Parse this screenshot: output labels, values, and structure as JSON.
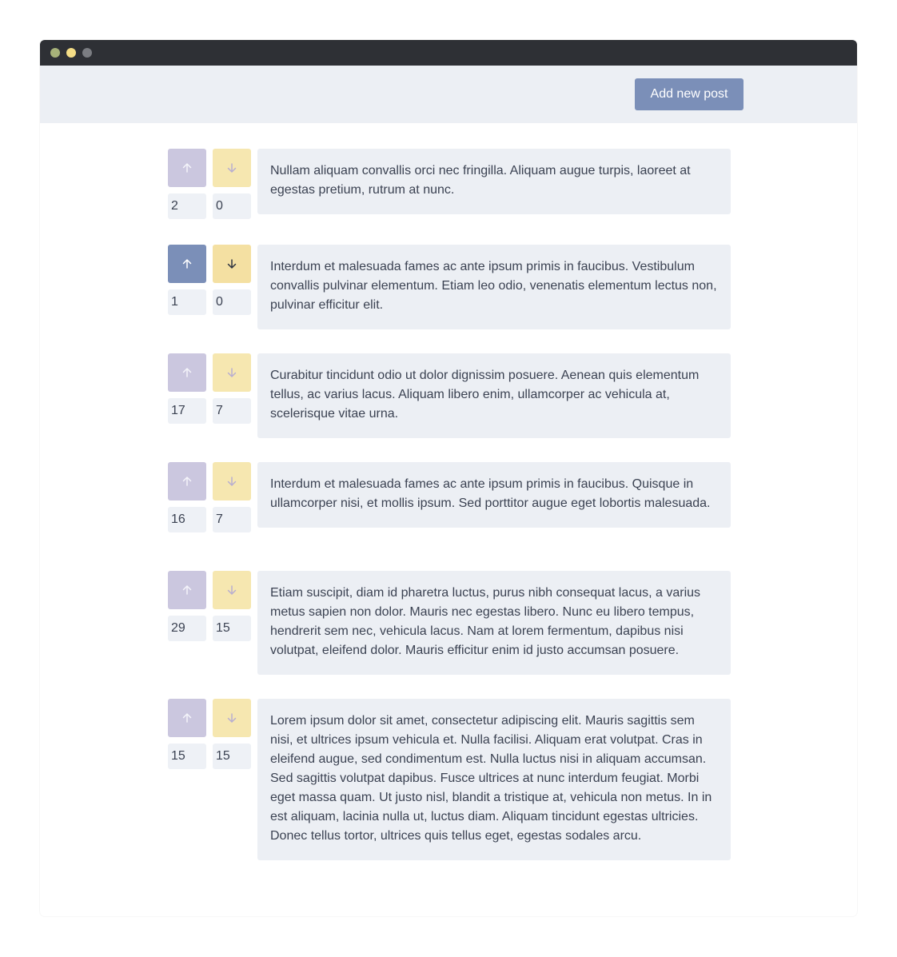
{
  "header": {
    "add_button_label": "Add new post"
  },
  "colors": {
    "titlebar": "#2e3035",
    "header_bg": "#eceff4",
    "accent": "#7b8fb8",
    "upvote_inactive": "#cbc7df",
    "downvote_inactive": "#f6e7b0"
  },
  "posts": [
    {
      "upvotes": "2",
      "downvotes": "0",
      "text": "Nullam aliquam convallis orci nec fringilla. Aliquam augue turpis, laoreet at egestas pretium, rutrum at nunc.",
      "active": false
    },
    {
      "upvotes": "1",
      "downvotes": "0",
      "text": "Interdum et malesuada fames ac ante ipsum primis in faucibus. Vestibulum convallis pulvinar elementum. Etiam leo odio, venenatis elementum lectus non, pulvinar efficitur elit.",
      "active": true
    },
    {
      "upvotes": "17",
      "downvotes": "7",
      "text": "Curabitur tincidunt odio ut dolor dignissim posuere. Aenean quis elementum tellus, ac varius lacus. Aliquam libero enim, ullamcorper ac vehicula at, scelerisque vitae urna.",
      "active": false
    },
    {
      "upvotes": "16",
      "downvotes": "7",
      "text": "Interdum et malesuada fames ac ante ipsum primis in faucibus. Quisque in ullamcorper nisi, et mollis ipsum. Sed porttitor augue eget lobortis malesuada.",
      "active": false
    },
    {
      "upvotes": "29",
      "downvotes": "15",
      "text": "Etiam suscipit, diam id pharetra luctus, purus nibh consequat lacus, a varius metus sapien non dolor. Mauris nec egestas libero. Nunc eu libero tempus, hendrerit sem nec, vehicula lacus. Nam at lorem fermentum, dapibus nisi volutpat, eleifend dolor. Mauris efficitur enim id justo accumsan posuere.",
      "active": false
    },
    {
      "upvotes": "15",
      "downvotes": "15",
      "text": "Lorem ipsum dolor sit amet, consectetur adipiscing elit. Mauris sagittis sem nisi, et ultrices ipsum vehicula et. Nulla facilisi. Aliquam erat volutpat. Cras in eleifend augue, sed condimentum est. Nulla luctus nisi in aliquam accumsan. Sed sagittis volutpat dapibus. Fusce ultrices at nunc interdum feugiat. Morbi eget massa quam. Ut justo nisl, blandit a tristique at, vehicula non metus. In in est aliquam, lacinia nulla ut, luctus diam. Aliquam tincidunt egestas ultricies. Donec tellus tortor, ultrices quis tellus eget, egestas sodales arcu.",
      "active": false
    }
  ]
}
